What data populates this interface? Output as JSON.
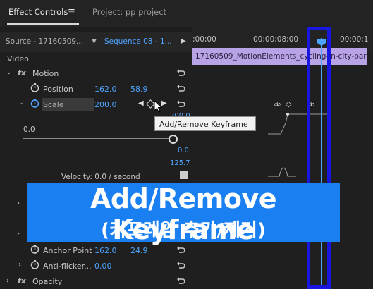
{
  "tabs": {
    "effect_controls": "Effect Controls",
    "menu_glyph": "≡",
    "project": "Project: pp project"
  },
  "source_bar": {
    "source": "Source - 17160509...",
    "sequence": "Sequence 08 - 1..."
  },
  "ruler": {
    "t1": ";00;00",
    "t2": "00;00;08;00",
    "t3": "00;00;1"
  },
  "clip_name": "17160509_MotionElements_cycling-in-city-par",
  "section": "Video",
  "motion": {
    "label": "Motion",
    "position_label": "Position",
    "position_x": "162.0",
    "position_y": "58.9",
    "scale_label": "Scale",
    "scale_value": "200.0",
    "slider_min": "0.0",
    "graph_top_value": "200.0",
    "value_0": "0.0",
    "value_125": "125.7",
    "velocity": "Velocity: 0.0 / second",
    "anchor_label": "Anchor Point",
    "anchor_x": "162.0",
    "anchor_y": "24.9",
    "antiflicker_label": "Anti-flicker...",
    "antiflicker_value": "0.00"
  },
  "opacity_label": "Opacity",
  "tooltip": "Add/Remove Keyframe",
  "banner": {
    "title": "Add/Remove Keyframe",
    "subtitle": "(키프레임 추가/제거)"
  },
  "colors": {
    "accent": "#4ea5ff",
    "banner": "#1a7ff0",
    "highlight": "#1717e0",
    "clip": "#b8a3e6"
  }
}
